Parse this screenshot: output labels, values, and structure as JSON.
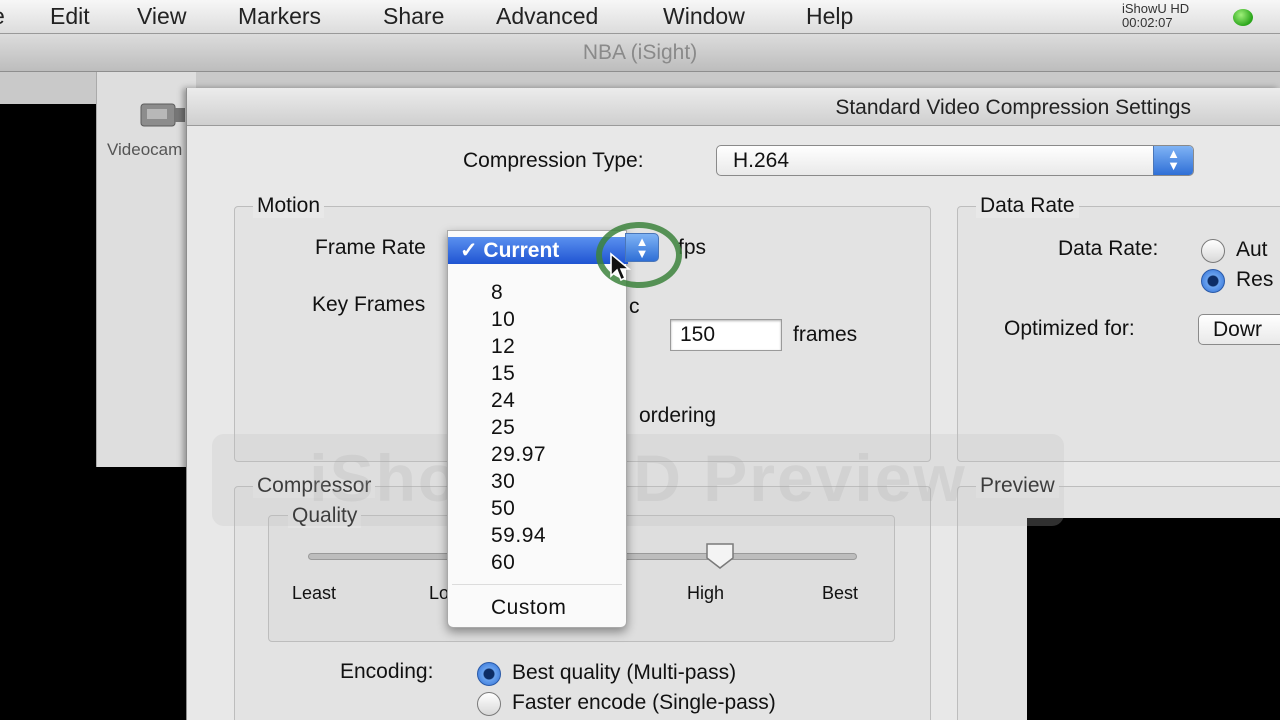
{
  "menubar": {
    "items": [
      "Edit",
      "View",
      "Markers",
      "Share",
      "Advanced",
      "Window",
      "Help"
    ],
    "edge_fragment": "e",
    "recorder_name": "iShowU HD",
    "recorder_time": "00:02:07"
  },
  "main_window": {
    "title": "NBA (iSight)",
    "source_label": "Videocam"
  },
  "dialog": {
    "title": "Standard Video Compression Settings",
    "compression_type_label": "Compression Type:",
    "compression_type_value": "H.264",
    "motion": {
      "title": "Motion",
      "frame_rate_label": "Frame Rate",
      "fps_unit": "fps",
      "key_frames_label": "Key Frames",
      "key_frames_partial": "c",
      "key_frames_value": "150",
      "frames_unit": "frames",
      "reordering_partial": "ordering"
    },
    "data_rate": {
      "title": "Data Rate",
      "data_rate_label": "Data Rate:",
      "option_auto": "Aut",
      "option_restrict": "Res",
      "optimized_label": "Optimized for:",
      "optimized_value": "Dowr"
    },
    "compressor": {
      "title": "Compressor",
      "quality_title": "Quality",
      "ticks": [
        "Least",
        "Lo",
        "High",
        "Best"
      ],
      "quality_level": 0.75,
      "encoding_label": "Encoding:",
      "encoding_options": [
        "Best quality (Multi-pass)",
        "Faster encode (Single-pass)"
      ],
      "encoding_selected": 0
    },
    "preview_title": "Preview"
  },
  "fps_menu": {
    "selected": "✓ Current",
    "options": [
      "8",
      "10",
      "12",
      "15",
      "24",
      "25",
      "29.97",
      "30",
      "50",
      "59.94",
      "60"
    ],
    "custom": "Custom"
  },
  "watermark": "iShowU HD Preview",
  "colors": {
    "accent": "#2f6fd6",
    "highlight_ring": "#3c823c",
    "status_green": "#2aa51a"
  }
}
